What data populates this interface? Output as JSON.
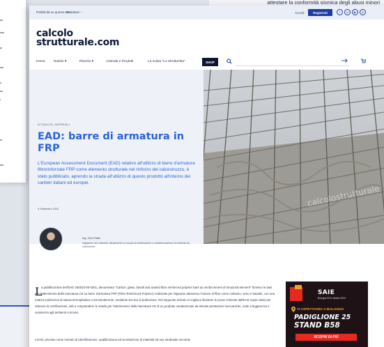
{
  "background": {
    "top_right_text": "attestare la conformità sismica degli abusi minori"
  },
  "topbar": {
    "links": [
      "Pubblicità su questo sito ›",
      "Contattaci ›"
    ],
    "login": "Accedi",
    "register": "Registrati",
    "social": [
      "f",
      "in",
      "▶",
      "◎"
    ]
  },
  "logo": {
    "line1": "calcolo",
    "line2": "strutturale.com"
  },
  "nav": {
    "items": [
      "Home",
      "Notizie ▾",
      "Risorse ▾",
      "Aziende e Prodotti",
      "La rivista \"Lo Strutturista\""
    ],
    "shop": "SHOP",
    "search_icon": "search-icon",
    "arrow_icon": "arrow-right-icon",
    "cart_icon": "cart-icon"
  },
  "article": {
    "category": "ATTUALITÀ, MATERIALI",
    "title": "EAD: barre di armatura in FRP",
    "lead": "L'European Assessment Document (EAD) relativo all'utilizzo di barre d'armatura fibrorinforzate FRP come elemento strutturale nel rinforzo del calcestruzzo, è stato pubblicato, aprendo la strada all'utilizzo di questo prodotto all'interno dei cantieri italiani ed europei.",
    "date": "9 Settembre 2024",
    "author_name": "Ing. Ciro Polito",
    "author_bio": "Ingegnere dei materiali, attualmente si occupa di certificazione e caratterizzazione di materiali da costruzione.",
    "dropcap": "L",
    "body_p1": "a pubblicazione dell'EAD 260023-00-0301, denominato \"Carbon, glass, basalt and aramid fibre reinforced polymer bars as reinforcement of structural element\" fornisce le basi per l'ottenimento della marcatura CE su barre d'armatura FRP (Fiber Reinforced Polymer) realizzate per l'appunto attraverso l'unione di fibre come carbonio, vetro e basalto, con una matrice polimerica di natura termoplastica o termoindurente, mediante tecnica di pultrusione. Nel seguente articolo si vogliono illustrare le prove richieste dall'EAD sopra citato per ottenere la certificazione, utili a comprendere le strade per l'ottenimento della marcatura CE di un prodotto caratterizzato da elevate prestazioni meccaniche, unite a leggerezza e resistenza agli ambienti corrosivi.",
    "body_p2": "L'EAD, previsto come metodo di identificazione, qualificazione ed accettazione di materiali ad uso strutturale secondo"
  },
  "ad": {
    "brand": "SAIE",
    "dates": "Bologna 9/12 ottobre 2024",
    "line1": "TI ASPETTIAMO A BOLOGNA",
    "line2": "PADIGLIONE 25",
    "line3": "STAND B58",
    "cta": "SCOPRI DI PIÙ"
  }
}
